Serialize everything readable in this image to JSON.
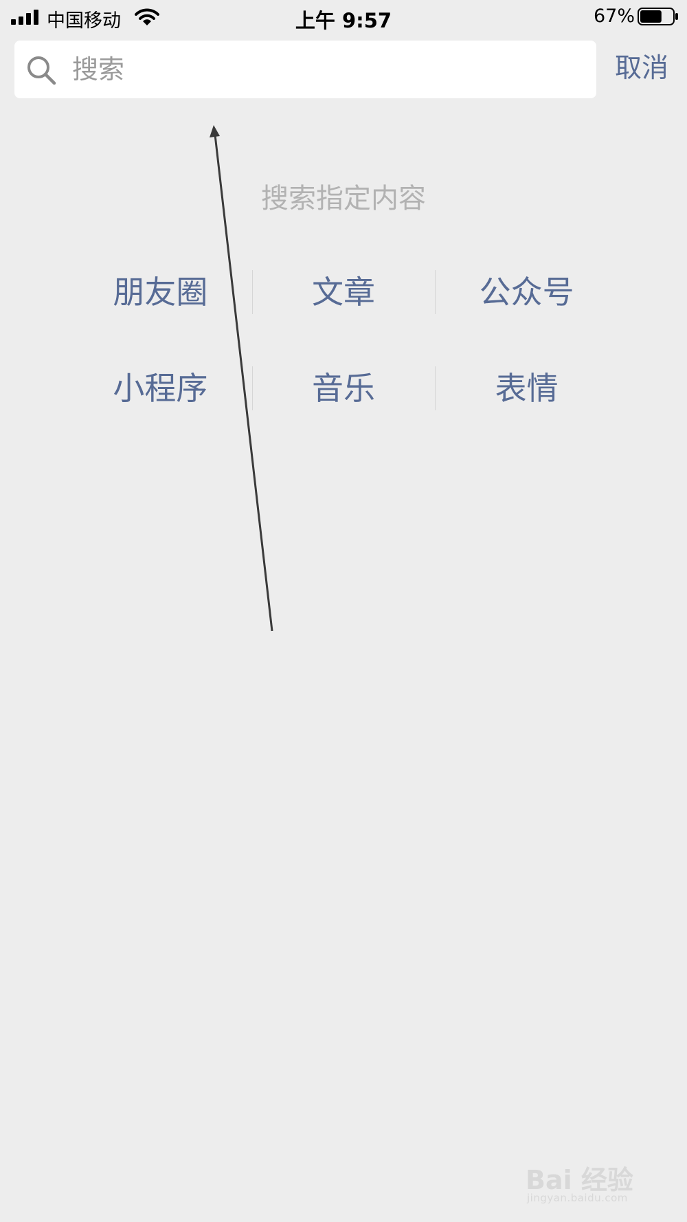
{
  "status_bar": {
    "carrier": "中国移动",
    "time": "上午 9:57",
    "battery_percent": "67%",
    "battery_level": 0.67,
    "icons": [
      "signal-icon",
      "wifi-icon",
      "battery-icon"
    ]
  },
  "search": {
    "placeholder": "搜索",
    "value": "",
    "cancel_label": "取消",
    "icon": "search-icon"
  },
  "hint": "搜索指定内容",
  "categories": [
    [
      "朋友圈",
      "文章",
      "公众号"
    ],
    [
      "小程序",
      "音乐",
      "表情"
    ]
  ],
  "watermark": {
    "brand": "Bai  经验",
    "url": "jingyan.baidu.com"
  },
  "colors": {
    "background": "#ededed",
    "link": "#576b95",
    "hint": "#b2b2b2",
    "search_box": "#ffffff"
  }
}
